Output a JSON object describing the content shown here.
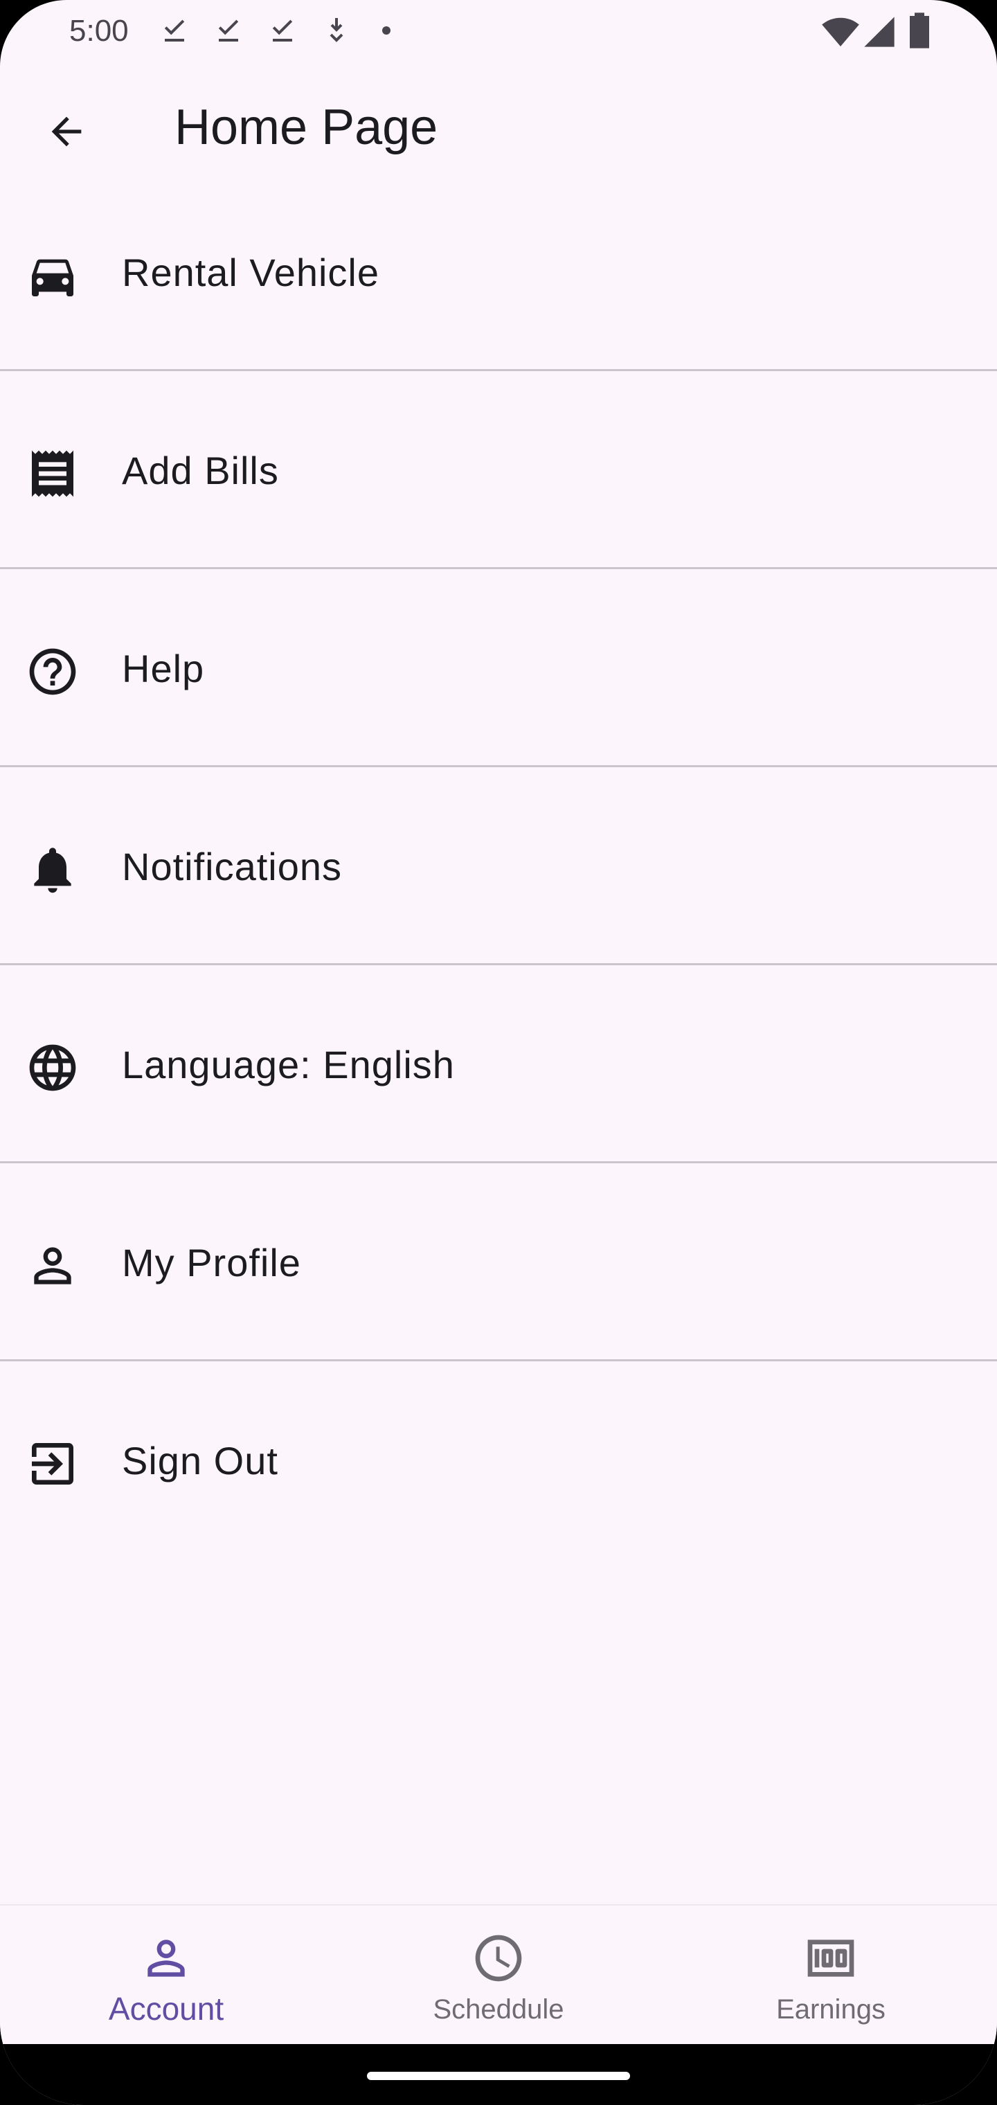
{
  "status_bar": {
    "time": "5:00",
    "left_icons": [
      "download-done-icon",
      "download-done-icon",
      "download-done-icon",
      "download-icon",
      "dot-icon"
    ],
    "right_icons": [
      "wifi-icon",
      "cell-signal-icon",
      "battery-icon"
    ]
  },
  "app_bar": {
    "back_icon": "arrow-back-icon",
    "title": "Home Page"
  },
  "menu": {
    "items": [
      {
        "icon": "car-icon",
        "label": "Rental Vehicle"
      },
      {
        "icon": "receipt-icon",
        "label": "Add Bills"
      },
      {
        "icon": "help-icon",
        "label": "Help"
      },
      {
        "icon": "bell-icon",
        "label": "Notifications"
      },
      {
        "icon": "globe-icon",
        "label": "Language: English"
      },
      {
        "icon": "person-icon",
        "label": "My Profile"
      },
      {
        "icon": "sign-out-icon",
        "label": "Sign Out"
      }
    ]
  },
  "bottom_nav": {
    "items": [
      {
        "icon": "person-icon",
        "label": "Account",
        "active": true
      },
      {
        "icon": "clock-icon",
        "label": "Scheddule",
        "active": false
      },
      {
        "icon": "money-icon",
        "label": "Earnings",
        "active": false
      }
    ]
  },
  "colors": {
    "background": "#fcf5fb",
    "text": "#1c1b1f",
    "divider": "#cac4cc",
    "active_nav": "#5f4ea2",
    "inactive_nav": "#6f6b73"
  }
}
